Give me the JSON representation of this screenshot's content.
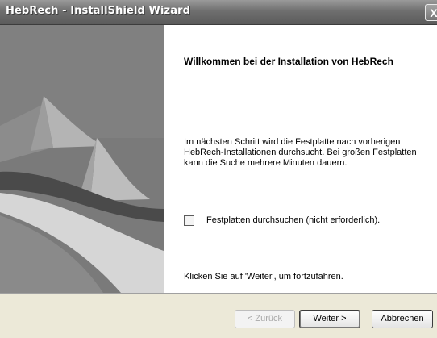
{
  "window": {
    "title": "HebRech - InstallShield Wizard",
    "close_glyph": "X"
  },
  "content": {
    "welcome_title": "Willkommen bei der Installation von HebRech",
    "description": "Im nächsten Schritt wird die Festplatte nach vorherigen HebRech-Installationen durchsucht. Bei großen Festplatten kann die Suche mehrere Minuten dauern.",
    "checkbox_label": "Festplatten durchsuchen (nicht erforderlich).",
    "checkbox_checked": false,
    "continue_text": "Klicken Sie auf 'Weiter', um fortzufahren."
  },
  "buttons": {
    "back": "< Zurück",
    "next": "Weiter >",
    "cancel": "Abbrechen"
  },
  "colors": {
    "titlebar": "#6f6f6f",
    "banner": "#7d7d7d",
    "dialog_background": "#ece9d8"
  },
  "icons": {
    "banner_graphic": "installshield-sail-graphic",
    "close": "close-icon"
  }
}
